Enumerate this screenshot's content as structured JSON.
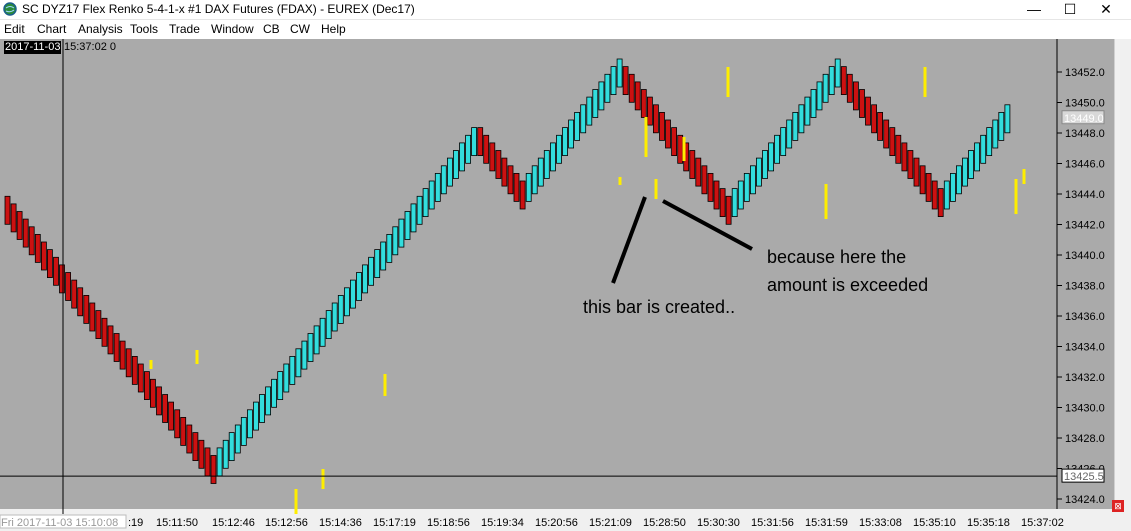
{
  "window": {
    "title": "SC DYZ17  Flex Renko 5-4-1-x  #1  DAX Futures (FDAX) - EUREX (Dec17)",
    "minimize_glyph": "—",
    "maximize_glyph": "☐",
    "close_glyph": "✕"
  },
  "menu": [
    "Edit",
    "Chart",
    "Analysis",
    "Tools",
    "Trade",
    "Window",
    "CB",
    "CW",
    "Help"
  ],
  "cursor_info": {
    "date": "2017-11-03",
    "time": "15:37:02 0",
    "bottom_readout": "Fri 2017-11-03  15:10:08"
  },
  "colors": {
    "chart_bg": "#aaaaaa",
    "up_bar": "#33dddd",
    "down_bar": "#cc1111",
    "wick": "#ffee00",
    "crosshair": "#000000",
    "price_marker_bg": "#ffffff"
  },
  "chart_data": {
    "type": "renko",
    "y_ticks": [
      "13452.0",
      "13450.0",
      "13448.0",
      "13446.0",
      "13444.0",
      "13442.0",
      "13440.0",
      "13438.0",
      "13436.0",
      "13434.0",
      "13432.0",
      "13430.0",
      "13428.0",
      "13426.0",
      "13424.0"
    ],
    "ylim": [
      13423.5,
      13453.0
    ],
    "current_price_label": "13449.0",
    "cursor_price_label": "13425.5",
    "x_tick_labels": [
      ":19",
      "15:11:50",
      "15:12:46",
      "15:12:56",
      "15:14:36",
      "15:17:19",
      "15:18:56",
      "15:19:34",
      "15:20:56",
      "15:21:09",
      "15:28:50",
      "15:30:30",
      "15:31:56",
      "15:31:59",
      "15:33:08",
      "15:35:10",
      "15:35:18",
      "15:37:02"
    ],
    "segments": [
      {
        "direction": "down",
        "start": 13443.0,
        "end": 13425.5
      },
      {
        "direction": "up",
        "start": 13426.0,
        "end": 13447.5
      },
      {
        "direction": "down",
        "start": 13447.5,
        "end": 13443.5
      },
      {
        "direction": "up",
        "start": 13444.0,
        "end": 13452.0
      },
      {
        "direction": "down",
        "start": 13451.5,
        "end": 13442.5
      },
      {
        "direction": "up",
        "start": 13443.0,
        "end": 13452.0
      },
      {
        "direction": "down",
        "start": 13451.5,
        "end": 13443.0
      },
      {
        "direction": "up",
        "start": 13443.5,
        "end": 13449.0
      }
    ],
    "annotations": [
      "because here the\namount is exceeded",
      "this bar is created.."
    ]
  }
}
